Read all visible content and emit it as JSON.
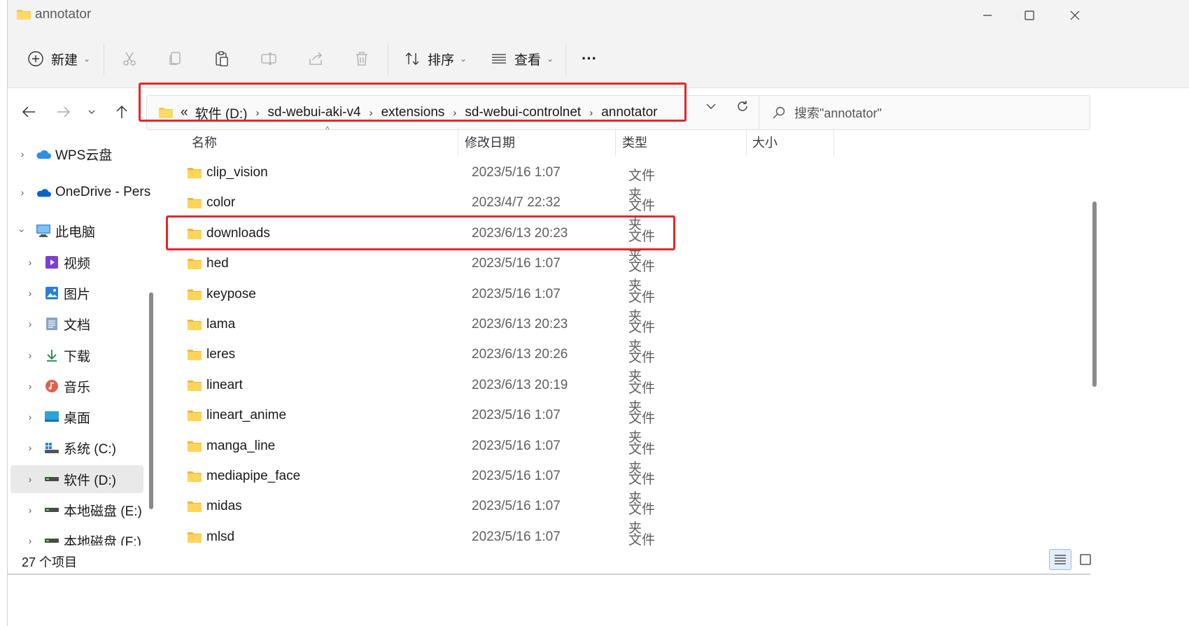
{
  "window": {
    "title": "annotator"
  },
  "toolbar": {
    "new_label": "新建",
    "sort_label": "排序",
    "view_label": "查看",
    "more_label": "···"
  },
  "address": {
    "overflow": "«",
    "crumbs": [
      "软件 (D:)",
      "sd-webui-aki-v4",
      "extensions",
      "sd-webui-controlnet",
      "annotator"
    ],
    "separator": "›"
  },
  "search": {
    "placeholder": "搜索\"annotator\""
  },
  "sidebar": {
    "items": [
      {
        "label": "WPS云盘",
        "icon": "cloud-icon"
      },
      {
        "label": "OneDrive - Pers",
        "icon": "onedrive-icon"
      },
      {
        "label": "此电脑",
        "icon": "computer-icon"
      },
      {
        "label": "视频",
        "icon": "video-icon"
      },
      {
        "label": "图片",
        "icon": "pictures-icon"
      },
      {
        "label": "文档",
        "icon": "document-icon"
      },
      {
        "label": "下载",
        "icon": "download-icon"
      },
      {
        "label": "音乐",
        "icon": "music-icon"
      },
      {
        "label": "桌面",
        "icon": "desktop-icon"
      },
      {
        "label": "系统 (C:)",
        "icon": "drive-c-icon"
      },
      {
        "label": "软件 (D:)",
        "icon": "drive-icon"
      },
      {
        "label": "本地磁盘 (E:)",
        "icon": "drive-icon"
      },
      {
        "label": "本地磁盘 (F:)",
        "icon": "drive-icon"
      }
    ]
  },
  "columns": {
    "name": "名称",
    "date": "修改日期",
    "type": "类型",
    "size": "大小"
  },
  "files": [
    {
      "name": "clip_vision",
      "date": "2023/5/16 1:07",
      "type": "文件夹"
    },
    {
      "name": "color",
      "date": "2023/4/7 22:32",
      "type": "文件夹"
    },
    {
      "name": "downloads",
      "date": "2023/6/13 20:23",
      "type": "文件夹"
    },
    {
      "name": "hed",
      "date": "2023/5/16 1:07",
      "type": "文件夹"
    },
    {
      "name": "keypose",
      "date": "2023/5/16 1:07",
      "type": "文件夹"
    },
    {
      "name": "lama",
      "date": "2023/6/13 20:23",
      "type": "文件夹"
    },
    {
      "name": "leres",
      "date": "2023/6/13 20:26",
      "type": "文件夹"
    },
    {
      "name": "lineart",
      "date": "2023/6/13 20:19",
      "type": "文件夹"
    },
    {
      "name": "lineart_anime",
      "date": "2023/5/16 1:07",
      "type": "文件夹"
    },
    {
      "name": "manga_line",
      "date": "2023/5/16 1:07",
      "type": "文件夹"
    },
    {
      "name": "mediapipe_face",
      "date": "2023/5/16 1:07",
      "type": "文件夹"
    },
    {
      "name": "midas",
      "date": "2023/5/16 1:07",
      "type": "文件夹"
    },
    {
      "name": "mlsd",
      "date": "2023/5/16 1:07",
      "type": "文件夹"
    }
  ],
  "status": {
    "count": "27 个项目"
  },
  "colors": {
    "highlight": "#e5262a",
    "folder": "#f7c948",
    "accent": "#0067c0"
  }
}
